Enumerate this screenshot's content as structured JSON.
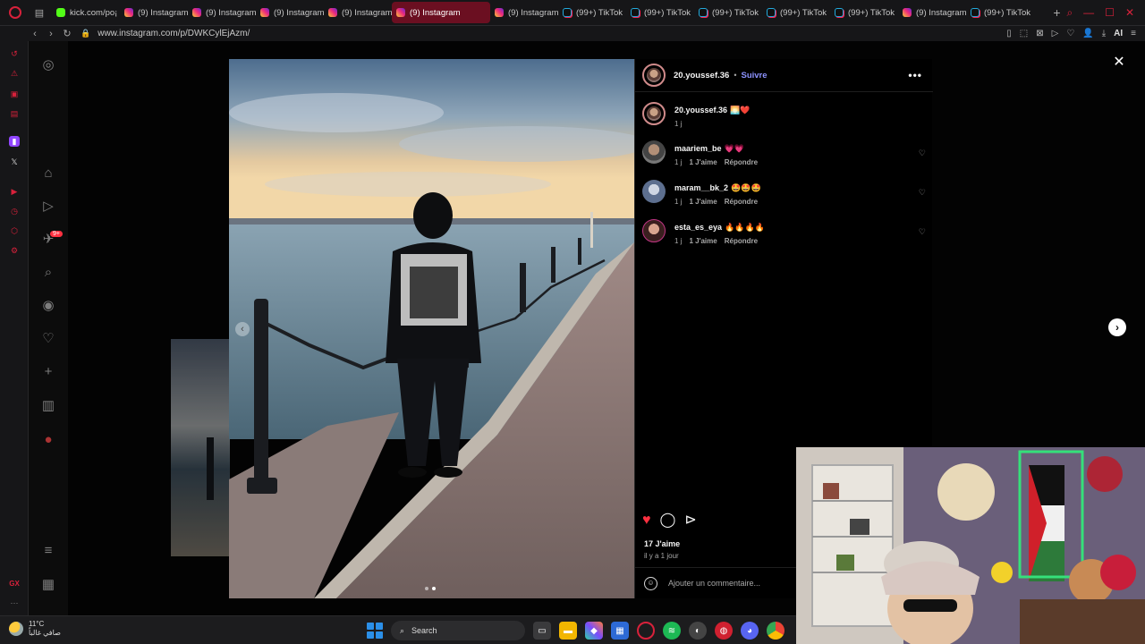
{
  "browser": {
    "tabs": [
      {
        "label": "kick.com/po¡",
        "icon": "kick-favicon"
      },
      {
        "label": "(9) Instagram",
        "icon": "instagram-favicon"
      },
      {
        "label": "(9) Instagram",
        "icon": "instagram-favicon"
      },
      {
        "label": "(9) Instagram",
        "icon": "instagram-favicon"
      },
      {
        "label": "(9) Instagram",
        "icon": "instagram-favicon"
      },
      {
        "label": "(9) Instagram",
        "icon": "instagram-favicon",
        "active": true
      },
      {
        "label": "(9) Instagram",
        "icon": "instagram-favicon"
      },
      {
        "label": "(99+) TikTok",
        "icon": "tiktok-favicon"
      },
      {
        "label": "(99+) TikTok",
        "icon": "tiktok-favicon"
      },
      {
        "label": "(99+) TikTok",
        "icon": "tiktok-favicon"
      },
      {
        "label": "(99+) TikTok",
        "icon": "tiktok-favicon"
      },
      {
        "label": "(99+) TikTok",
        "icon": "tiktok-favicon"
      },
      {
        "label": "(9) Instagram",
        "icon": "instagram-favicon"
      },
      {
        "label": "(99+) TikTok",
        "icon": "tiktok-favicon"
      }
    ],
    "url": "www.instagram.com/p/DWKCylEjAzm/",
    "ai_label": "AI",
    "accent": "#d8213b"
  },
  "post": {
    "author": "20.youssef.36",
    "separator": "•",
    "follow_label": "Suivre",
    "more_label": "•••",
    "comments": [
      {
        "user": "20.youssef.36",
        "text": "🌅❤️",
        "time": "1 j",
        "likes": "",
        "reply": ""
      },
      {
        "user": "maariem_be",
        "text": "💗💗",
        "time": "1 j",
        "likes": "1 J'aime",
        "reply": "Répondre"
      },
      {
        "user": "maram__bk_2",
        "text": "🤩🤩🤩",
        "time": "1 j",
        "likes": "1 J'aime",
        "reply": "Répondre"
      },
      {
        "user": "esta_es_eya",
        "text": "🔥🔥🔥🔥",
        "time": "1 j",
        "likes": "1 J'aime",
        "reply": "Répondre"
      }
    ],
    "likes_count": "17 J'aime",
    "posted_ago": "il y a 1 jour",
    "comment_placeholder": "Ajouter un commentaire..."
  },
  "taskbar": {
    "temperature": "11°C",
    "weather_desc": "صافي غالباً",
    "search_label": "Search"
  },
  "icons": {
    "like": "heart-filled-icon",
    "comment": "comment-bubble-icon",
    "share": "paper-plane-icon",
    "close": "close-icon",
    "next": "chevron-right-icon",
    "prev": "chevron-left-icon"
  },
  "colors": {
    "like_red": "#ff3040",
    "follow_blue": "#8d93ff",
    "active_tab": "#6b0f21"
  }
}
